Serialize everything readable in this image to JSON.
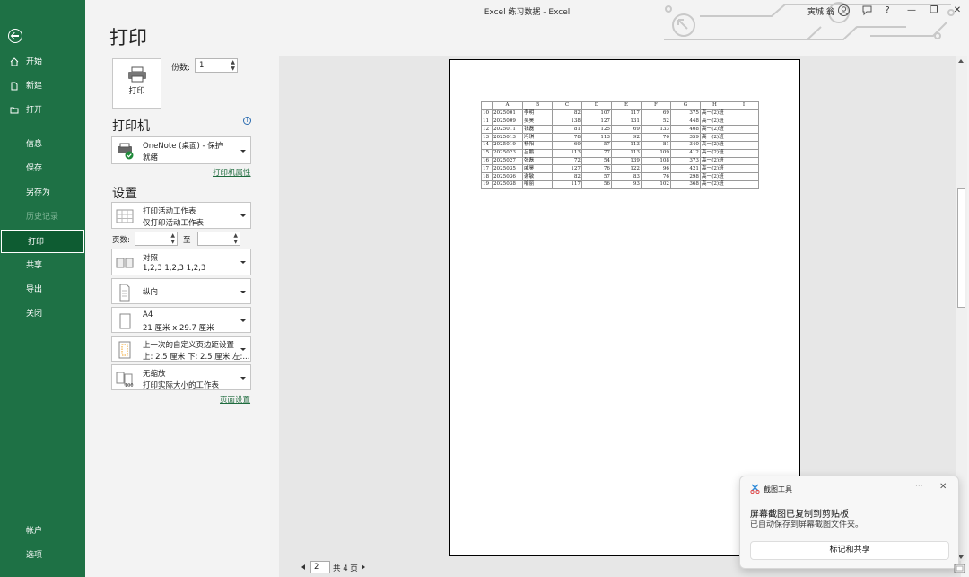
{
  "window": {
    "title": "Excel 练习数据 - Excel",
    "user": "寅城 翁"
  },
  "title_controls": {
    "help": "?",
    "minimize": "—",
    "restore": "❐",
    "close": "✕"
  },
  "page_title": "打印",
  "nav": {
    "items": [
      {
        "label": "开始",
        "icon": "home-icon"
      },
      {
        "label": "新建",
        "icon": "new-file-icon"
      },
      {
        "label": "打开",
        "icon": "open-folder-icon"
      },
      {
        "label": "信息"
      },
      {
        "label": "保存"
      },
      {
        "label": "另存为"
      },
      {
        "label": "历史记录",
        "disabled": true
      },
      {
        "label": "打印",
        "active": true
      },
      {
        "label": "共享"
      },
      {
        "label": "导出"
      },
      {
        "label": "关闭"
      }
    ],
    "bottom": [
      {
        "label": "帐户"
      },
      {
        "label": "选项"
      }
    ]
  },
  "print_button": {
    "label": "打印"
  },
  "copies": {
    "label": "份数:",
    "value": "1"
  },
  "printer": {
    "heading": "打印机",
    "name": "OneNote (桌面) - 保护",
    "status": "就绪",
    "properties_link": "打印机属性"
  },
  "settings": {
    "heading": "设置",
    "what": {
      "line1": "打印活动工作表",
      "line2": "仅打印活动工作表"
    },
    "pages_label": "页数:",
    "to_label": "至",
    "collate": {
      "line1": "对照",
      "line2": "1,2,3    1,2,3    1,2,3"
    },
    "orientation": {
      "line1": "纵向"
    },
    "paper": {
      "line1": "A4",
      "line2": "21 厘米 x 29.7 厘米"
    },
    "margins": {
      "line1": "上一次的自定义页边距设置",
      "line2": "上: 2.5 厘米 下: 2.5 厘米 左:..."
    },
    "scaling": {
      "line1": "无缩放",
      "line2": "打印实际大小的工作表"
    },
    "page_setup_link": "页面设置"
  },
  "preview": {
    "columns": [
      "",
      "A",
      "B",
      "C",
      "D",
      "E",
      "F",
      "G",
      "H",
      "I"
    ],
    "rows": [
      [
        "10",
        "2025001",
        "李明",
        "82",
        "107",
        "117",
        "69",
        "375",
        "高一(2)班",
        ""
      ],
      [
        "11",
        "2025009",
        "吴昊",
        "138",
        "127",
        "131",
        "52",
        "448",
        "高一(2)班",
        ""
      ],
      [
        "12",
        "2025011",
        "钱磊",
        "81",
        "125",
        "69",
        "133",
        "408",
        "高一(2)班",
        ""
      ],
      [
        "13",
        "2025013",
        "冯琪",
        "78",
        "113",
        "92",
        "76",
        "359",
        "高一(2)班",
        ""
      ],
      [
        "14",
        "2025019",
        "杨阳",
        "69",
        "57",
        "113",
        "81",
        "340",
        "高一(2)班",
        ""
      ],
      [
        "15",
        "2025023",
        "吕鹏",
        "113",
        "77",
        "113",
        "109",
        "412",
        "高一(2)班",
        ""
      ],
      [
        "16",
        "2025027",
        "张磊",
        "72",
        "54",
        "139",
        "108",
        "373",
        "高一(2)班",
        ""
      ],
      [
        "17",
        "2025035",
        "戚昊",
        "127",
        "76",
        "122",
        "96",
        "421",
        "高一(2)班",
        ""
      ],
      [
        "18",
        "2025036",
        "谢敏",
        "82",
        "57",
        "83",
        "76",
        "298",
        "高一(2)班",
        ""
      ],
      [
        "19",
        "2025038",
        "喻丽",
        "117",
        "56",
        "93",
        "102",
        "368",
        "高一(2)班",
        ""
      ]
    ],
    "page_current": "2",
    "page_total": "共 4 页"
  },
  "toast": {
    "app": "截图工具",
    "more": "···",
    "close": "✕",
    "title": "屏幕截图已复制到剪贴板",
    "body": "已自动保存到屏幕截图文件夹。",
    "action": "标记和共享"
  },
  "colors": {
    "sidebar": "#1e7145",
    "accent_link": "#1e6b3d"
  }
}
